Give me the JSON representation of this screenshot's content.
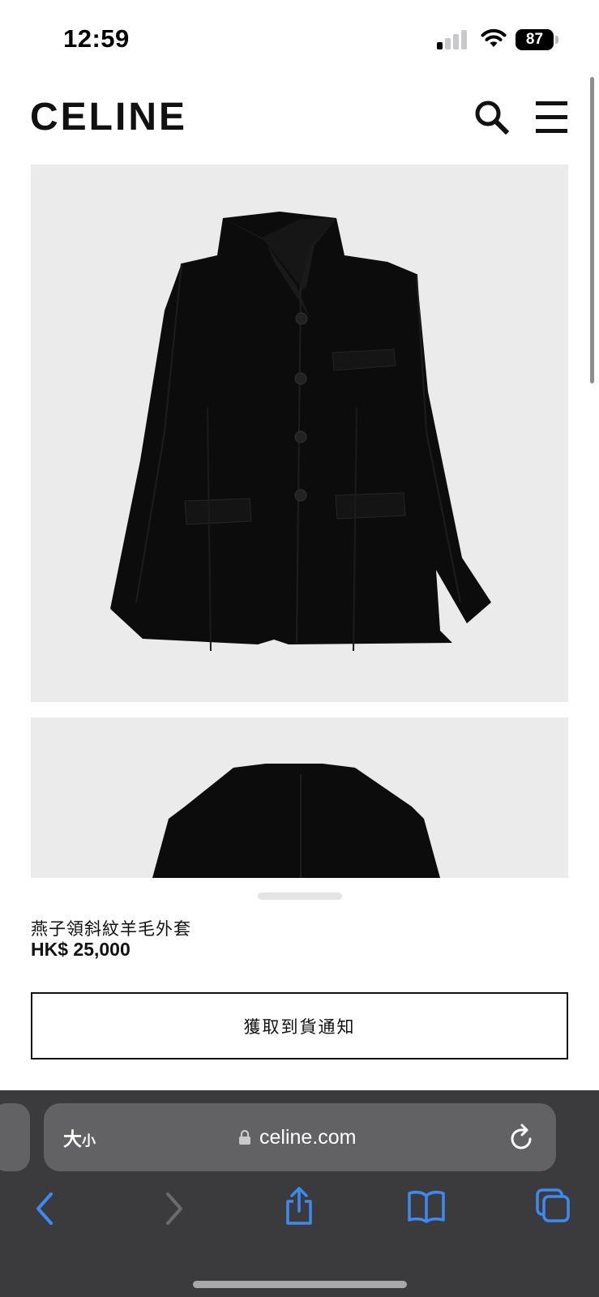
{
  "status_bar": {
    "time": "12:59",
    "battery": "87",
    "signal_bars_active": 1,
    "signal_bars_total": 4
  },
  "header": {
    "logo": "CELINE",
    "icons": [
      "search-icon",
      "hamburger-menu-icon"
    ]
  },
  "product": {
    "name": "燕子領斜紋羊毛外套",
    "price": "HK$ 25,000",
    "notify_button_label": "獲取到貨通知",
    "image_count_visible": 2
  },
  "browser": {
    "text_size_label_big": "大",
    "text_size_label_small": "小",
    "url": "celine.com",
    "toolbar_icons": [
      "back-icon",
      "forward-icon",
      "share-icon",
      "bookmarks-icon",
      "tabs-icon"
    ],
    "accent_color": "#3d8bf2",
    "disabled_color": "#6b6b6f"
  },
  "colors": {
    "page_background": "#ffffff",
    "image_background": "#ebebeb",
    "text": "#111111",
    "browser_chrome": "#3b3b3d",
    "address_field": "#626265"
  }
}
